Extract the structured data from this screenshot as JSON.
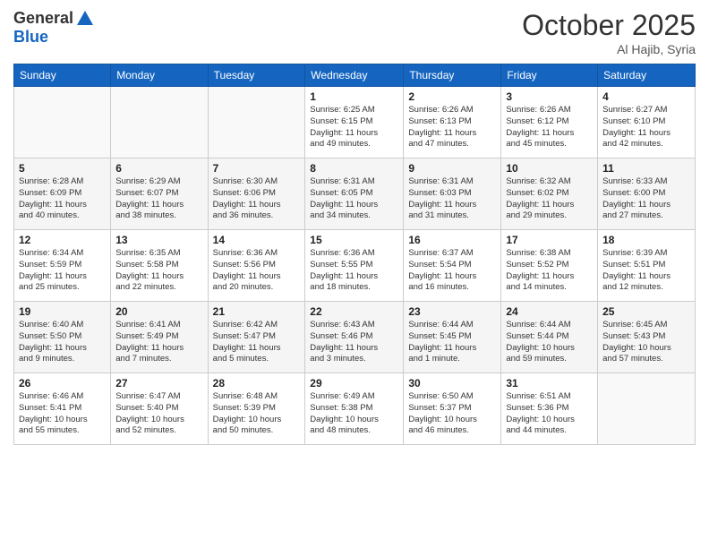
{
  "logo": {
    "line1": "General",
    "line2": "Blue"
  },
  "header": {
    "month": "October 2025",
    "location": "Al Hajib, Syria"
  },
  "weekdays": [
    "Sunday",
    "Monday",
    "Tuesday",
    "Wednesday",
    "Thursday",
    "Friday",
    "Saturday"
  ],
  "weeks": [
    [
      {
        "day": "",
        "info": ""
      },
      {
        "day": "",
        "info": ""
      },
      {
        "day": "",
        "info": ""
      },
      {
        "day": "1",
        "info": "Sunrise: 6:25 AM\nSunset: 6:15 PM\nDaylight: 11 hours\nand 49 minutes."
      },
      {
        "day": "2",
        "info": "Sunrise: 6:26 AM\nSunset: 6:13 PM\nDaylight: 11 hours\nand 47 minutes."
      },
      {
        "day": "3",
        "info": "Sunrise: 6:26 AM\nSunset: 6:12 PM\nDaylight: 11 hours\nand 45 minutes."
      },
      {
        "day": "4",
        "info": "Sunrise: 6:27 AM\nSunset: 6:10 PM\nDaylight: 11 hours\nand 42 minutes."
      }
    ],
    [
      {
        "day": "5",
        "info": "Sunrise: 6:28 AM\nSunset: 6:09 PM\nDaylight: 11 hours\nand 40 minutes."
      },
      {
        "day": "6",
        "info": "Sunrise: 6:29 AM\nSunset: 6:07 PM\nDaylight: 11 hours\nand 38 minutes."
      },
      {
        "day": "7",
        "info": "Sunrise: 6:30 AM\nSunset: 6:06 PM\nDaylight: 11 hours\nand 36 minutes."
      },
      {
        "day": "8",
        "info": "Sunrise: 6:31 AM\nSunset: 6:05 PM\nDaylight: 11 hours\nand 34 minutes."
      },
      {
        "day": "9",
        "info": "Sunrise: 6:31 AM\nSunset: 6:03 PM\nDaylight: 11 hours\nand 31 minutes."
      },
      {
        "day": "10",
        "info": "Sunrise: 6:32 AM\nSunset: 6:02 PM\nDaylight: 11 hours\nand 29 minutes."
      },
      {
        "day": "11",
        "info": "Sunrise: 6:33 AM\nSunset: 6:00 PM\nDaylight: 11 hours\nand 27 minutes."
      }
    ],
    [
      {
        "day": "12",
        "info": "Sunrise: 6:34 AM\nSunset: 5:59 PM\nDaylight: 11 hours\nand 25 minutes."
      },
      {
        "day": "13",
        "info": "Sunrise: 6:35 AM\nSunset: 5:58 PM\nDaylight: 11 hours\nand 22 minutes."
      },
      {
        "day": "14",
        "info": "Sunrise: 6:36 AM\nSunset: 5:56 PM\nDaylight: 11 hours\nand 20 minutes."
      },
      {
        "day": "15",
        "info": "Sunrise: 6:36 AM\nSunset: 5:55 PM\nDaylight: 11 hours\nand 18 minutes."
      },
      {
        "day": "16",
        "info": "Sunrise: 6:37 AM\nSunset: 5:54 PM\nDaylight: 11 hours\nand 16 minutes."
      },
      {
        "day": "17",
        "info": "Sunrise: 6:38 AM\nSunset: 5:52 PM\nDaylight: 11 hours\nand 14 minutes."
      },
      {
        "day": "18",
        "info": "Sunrise: 6:39 AM\nSunset: 5:51 PM\nDaylight: 11 hours\nand 12 minutes."
      }
    ],
    [
      {
        "day": "19",
        "info": "Sunrise: 6:40 AM\nSunset: 5:50 PM\nDaylight: 11 hours\nand 9 minutes."
      },
      {
        "day": "20",
        "info": "Sunrise: 6:41 AM\nSunset: 5:49 PM\nDaylight: 11 hours\nand 7 minutes."
      },
      {
        "day": "21",
        "info": "Sunrise: 6:42 AM\nSunset: 5:47 PM\nDaylight: 11 hours\nand 5 minutes."
      },
      {
        "day": "22",
        "info": "Sunrise: 6:43 AM\nSunset: 5:46 PM\nDaylight: 11 hours\nand 3 minutes."
      },
      {
        "day": "23",
        "info": "Sunrise: 6:44 AM\nSunset: 5:45 PM\nDaylight: 11 hours\nand 1 minute."
      },
      {
        "day": "24",
        "info": "Sunrise: 6:44 AM\nSunset: 5:44 PM\nDaylight: 10 hours\nand 59 minutes."
      },
      {
        "day": "25",
        "info": "Sunrise: 6:45 AM\nSunset: 5:43 PM\nDaylight: 10 hours\nand 57 minutes."
      }
    ],
    [
      {
        "day": "26",
        "info": "Sunrise: 6:46 AM\nSunset: 5:41 PM\nDaylight: 10 hours\nand 55 minutes."
      },
      {
        "day": "27",
        "info": "Sunrise: 6:47 AM\nSunset: 5:40 PM\nDaylight: 10 hours\nand 52 minutes."
      },
      {
        "day": "28",
        "info": "Sunrise: 6:48 AM\nSunset: 5:39 PM\nDaylight: 10 hours\nand 50 minutes."
      },
      {
        "day": "29",
        "info": "Sunrise: 6:49 AM\nSunset: 5:38 PM\nDaylight: 10 hours\nand 48 minutes."
      },
      {
        "day": "30",
        "info": "Sunrise: 6:50 AM\nSunset: 5:37 PM\nDaylight: 10 hours\nand 46 minutes."
      },
      {
        "day": "31",
        "info": "Sunrise: 6:51 AM\nSunset: 5:36 PM\nDaylight: 10 hours\nand 44 minutes."
      },
      {
        "day": "",
        "info": ""
      }
    ]
  ]
}
